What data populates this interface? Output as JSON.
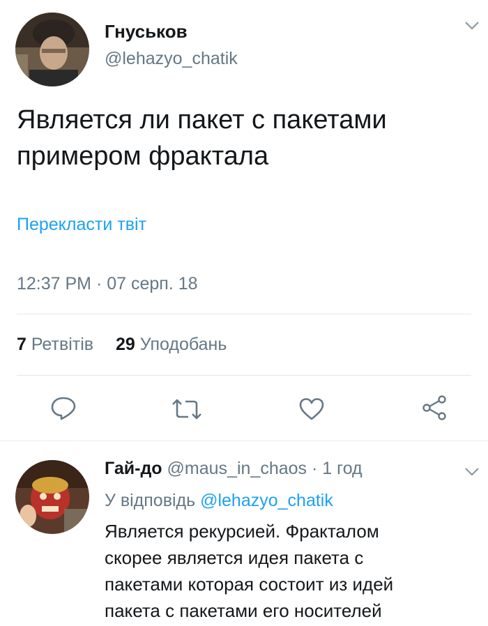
{
  "tweet": {
    "author_name": "Гнуськов",
    "author_handle": "@lehazyo_chatik",
    "text_line1": "Является ли пакет с пакетами",
    "text_line2": "примером фрактала",
    "translate_label": "Перекласти твіт",
    "timestamp": "12:37 PM · 07 серп. 18",
    "retweet_count": "7",
    "retweet_label": "Ретвітів",
    "like_count": "29",
    "like_label": "Уподобань"
  },
  "reply": {
    "author_name": "Гай-до",
    "author_handle": "@maus_in_chaos",
    "time_ago": "· 1 год",
    "replying_prefix": "У відповідь",
    "replying_to": "@lehazyo_chatik",
    "text_line1": "Является рекурсией. Фракталом",
    "text_line2": "скорее является идея пакета с",
    "text_line3": "пакетами которая состоит из идей",
    "text_line4": "пакета с пакетами его носителей"
  },
  "icons": {
    "reply": "reply-icon",
    "retweet": "retweet-icon",
    "like": "heart-icon",
    "share": "share-icon",
    "more": "chevron-down-icon"
  },
  "colors": {
    "accent": "#1da1f2",
    "secondary_text": "#657786",
    "divider": "#e1e8ed"
  }
}
